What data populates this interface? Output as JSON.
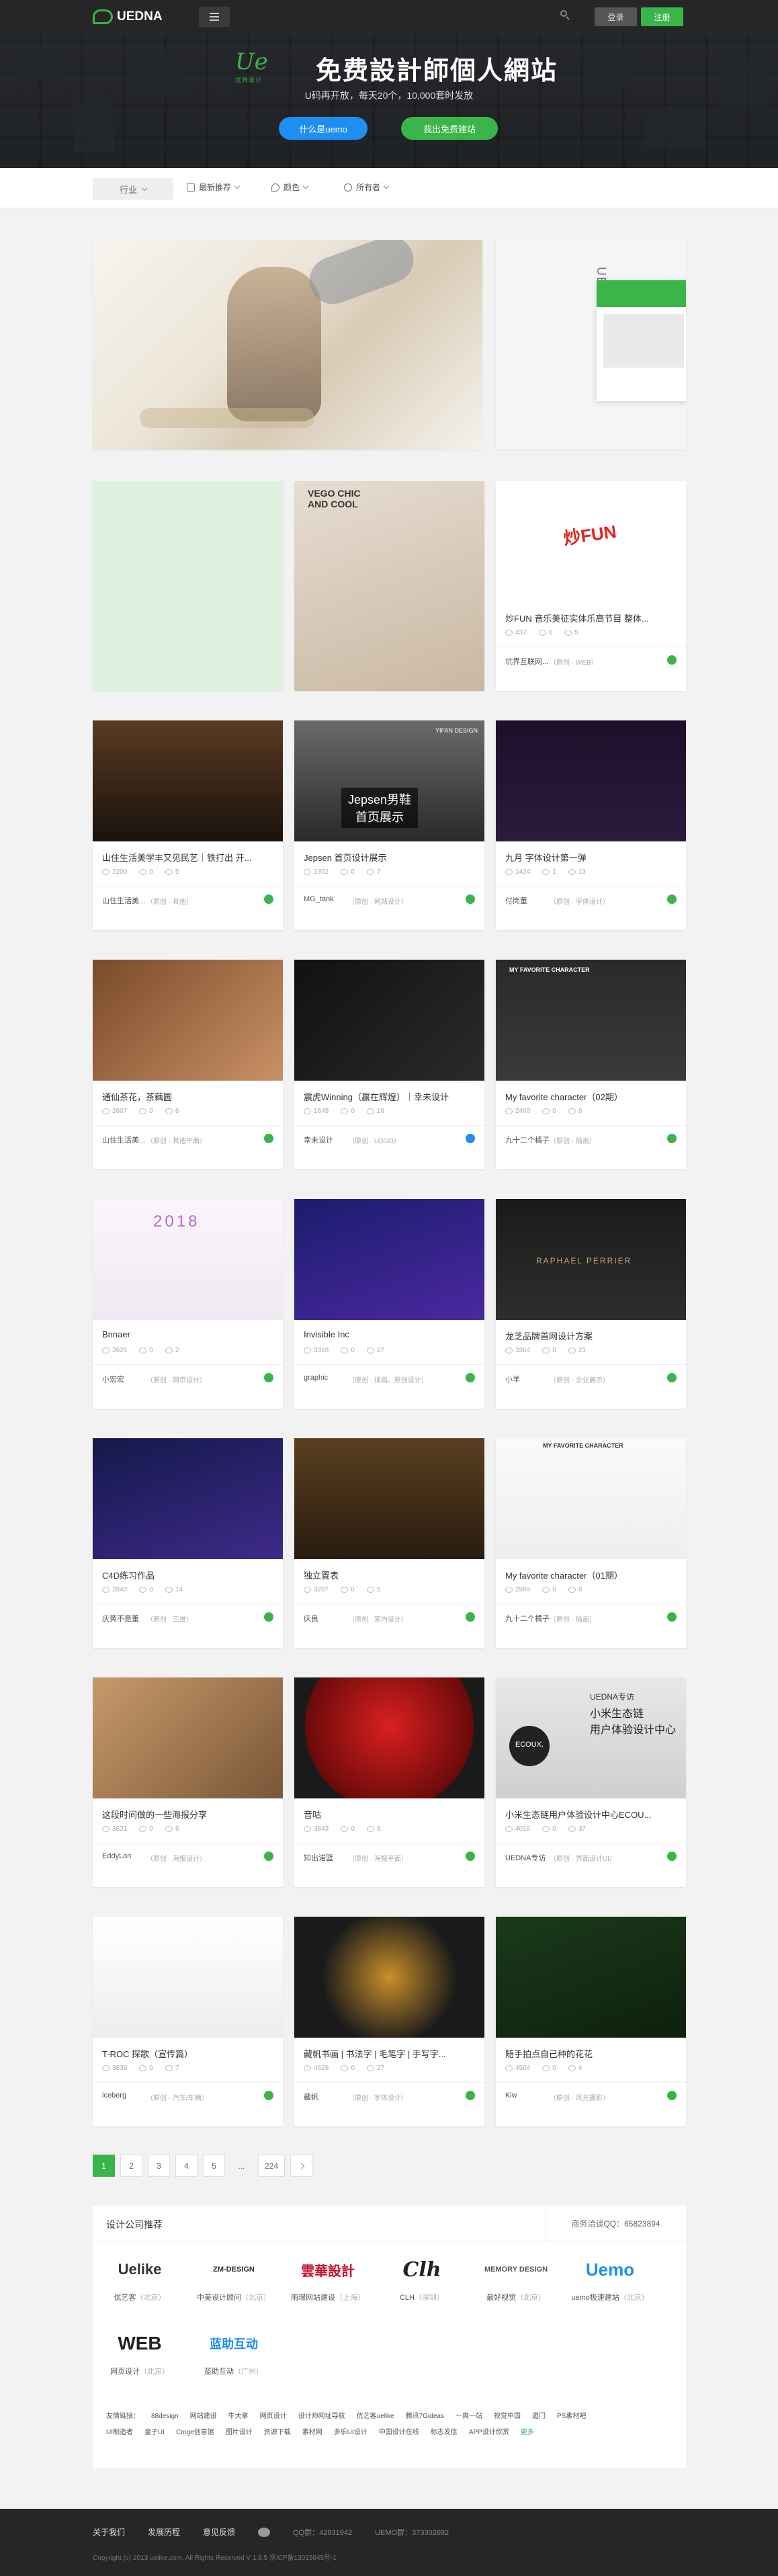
{
  "nav": {
    "logo": "UEDNA",
    "login": "登录",
    "register": "注册"
  },
  "banner": {
    "logo_text": "Ue",
    "logo_sub": "优异设计",
    "title": "免费設計師個人網站",
    "subtitle": "U码再开放，每天20个，10,000套时发放",
    "btn_what": "什么是uemo",
    "btn_free": "我出免费建站"
  },
  "filters": {
    "category": "行业",
    "sort": "最新推荐",
    "color": "颜色",
    "owner": "所有者"
  },
  "cards": [
    {
      "title": "炒FUN 音乐美征实体乐高节目 整体...",
      "views": "437",
      "comments": "0",
      "likes": "5",
      "author": "坑界互联网...",
      "meta": "（原创 · WEB）",
      "badge": "green"
    },
    {
      "title": "山住生活美学丰又见民艺｜铁打出 开...",
      "views": "2200",
      "comments": "0",
      "likes": "5",
      "author": "山住生活美...",
      "meta": "（原创 · 其他）",
      "badge": "green"
    },
    {
      "title": "Jepsen 首页设计展示",
      "views": "1302",
      "comments": "0",
      "likes": "7",
      "author": "MG_tank",
      "meta": "（原创 · 网站设计）",
      "badge": "green"
    },
    {
      "title": "九月 字体设计第一弹",
      "views": "1424",
      "comments": "1",
      "likes": "13",
      "author": "付岗董",
      "meta": "（原创 · 字体设计）",
      "badge": "green"
    },
    {
      "title": "通仙茶花，茶藕圆",
      "views": "2607",
      "comments": "0",
      "likes": "6",
      "author": "山住生活美...",
      "meta": "（原创 · 其他平面）",
      "badge": "green"
    },
    {
      "title": "震虎Winning（赢在辉煌）｜幸未设计",
      "views": "1649",
      "comments": "0",
      "likes": "16",
      "author": "幸未设计",
      "meta": "（原创 · LOGO）",
      "badge": "blue"
    },
    {
      "title": "My favorite character（02期）",
      "views": "2460",
      "comments": "0",
      "likes": "6",
      "author": "九十二个橘子",
      "meta": "（原创 · 插画）",
      "badge": "green"
    },
    {
      "title": "Bnnaer",
      "views": "2626",
      "comments": "0",
      "likes": "2",
      "author": "小宏宏",
      "meta": "（原创 · 网页设计）",
      "badge": "green"
    },
    {
      "title": "Invisible Inc",
      "views": "3318",
      "comments": "0",
      "likes": "27",
      "author": "graphic",
      "meta": "（原创 · 插画、原创设计）",
      "badge": "green"
    },
    {
      "title": "龙芝品牌首网设计方案",
      "views": "3364",
      "comments": "0",
      "likes": "21",
      "author": "小羊",
      "meta": "（原创 · 企业展示）",
      "badge": "green"
    },
    {
      "title": "C4D练习作品",
      "views": "2840",
      "comments": "0",
      "likes": "14",
      "author": "庆黄不是董",
      "meta": "（原创 · 三维）",
      "badge": "green"
    },
    {
      "title": "独立置表",
      "views": "3207",
      "comments": "0",
      "likes": "5",
      "author": "庆良",
      "meta": "（原创 · 室内设计）",
      "badge": "green"
    },
    {
      "title": "My favorite character（01期）",
      "views": "2989",
      "comments": "0",
      "likes": "8",
      "author": "九十二个橘子",
      "meta": "（原创 · 插画）",
      "badge": "green"
    },
    {
      "title": "这段时间做的一些海报分享",
      "views": "3621",
      "comments": "0",
      "likes": "6",
      "author": "EddyLon",
      "meta": "（原创 · 海报设计）",
      "badge": "green"
    },
    {
      "title": "音咕",
      "views": "3843",
      "comments": "0",
      "likes": "9",
      "author": "知出诺篮",
      "meta": "（原创 · 海报平面）",
      "badge": "green"
    },
    {
      "title": "小米生态链用户体验设计中心ECOU...",
      "views": "4010",
      "comments": "0",
      "likes": "37",
      "author": "UEDNA专访",
      "meta": "（原创 · 界面设计UI）",
      "badge": "green"
    },
    {
      "title": "T-ROC 探歌（宣传篇）",
      "views": "3839",
      "comments": "0",
      "likes": "7",
      "author": "iceberg",
      "meta": "（原创 · 汽车/车辆）",
      "badge": "green"
    },
    {
      "title": "藏帆书画 | 书法字 | 毛笔字 | 手写字...",
      "views": "4629",
      "comments": "0",
      "likes": "27",
      "author": "藏帆",
      "meta": "（原创 · 字体设计）",
      "badge": "green"
    },
    {
      "title": "随手拍点自己种的花花",
      "views": "4504",
      "comments": "0",
      "likes": "4",
      "author": "Kiw",
      "meta": "（原创 · 风光摄影）",
      "badge": "green"
    }
  ],
  "image_labels": {
    "uemo": "UEMO企业版",
    "jepsen": "Jepsen男鞋\n首页展示",
    "raphael": "RAPHAEL PERRIER",
    "mfc": "MY FAVORITE CHARACTER",
    "ecoux": "ECOUX.",
    "ecoux_side": "小米生态链\n用户体验设计中心",
    "uedna_tag": "UEDNA专访",
    "yifan": "YIFAN DESIGN",
    "chic": "VEGO CHIC AND COOL",
    "bdate": "2018",
    "chaofun": "炒FUN"
  },
  "pager": [
    "1",
    "2",
    "3",
    "4",
    "5",
    "...",
    "224"
  ],
  "companies": {
    "title": "设计公司推荐",
    "contact": "商务洽谈QQ：65823894",
    "items": [
      {
        "logo": "Uelike",
        "name": "优艺客",
        "city": "（北京）"
      },
      {
        "logo": "ZM-DESIGN",
        "name": "中美设计顾问",
        "city": "（北京）"
      },
      {
        "logo": "雲華設計",
        "name": "雨璟网站建设",
        "city": "（上海）"
      },
      {
        "logo": "Clh",
        "name": "CLH",
        "city": "（深圳）"
      },
      {
        "logo": "MEMORY DESIGN",
        "name": "最好视觉",
        "city": "（北京）"
      },
      {
        "logo": "Uemo",
        "name": "uemo极速建站",
        "city": "（北京）"
      },
      {
        "logo": "WEB",
        "name": "网页设计",
        "city": "（北京）"
      },
      {
        "logo": "蓝助互动",
        "name": "蓝助互动",
        "city": "（广州）"
      }
    ]
  },
  "links": {
    "line1": [
      "友情链接：",
      "88design",
      "网站建设",
      "牛大拿",
      "网页设计",
      "设计师网址导航",
      "优艺客uelike",
      "腾讯7Gideas",
      "一爽一站",
      "视觉中国",
      "遨门",
      "PS素材吧"
    ],
    "line2": [
      "UI制造者",
      "皇子UI",
      "Cmge创意馆",
      "图片设计",
      "资源下载",
      "素材网",
      "多乐UI设计",
      "中国设计在线",
      "标志发信",
      "APP设计欣赏",
      "更多"
    ]
  },
  "footer": {
    "about": "关于我们",
    "history": "发展历程",
    "feedback": "意见反馈",
    "qq1": "QQ群：42831942",
    "qq2": "UEMO群：373302692",
    "copyright": "Copyright (c) 2013 uelike.com. All Rights Reserved V 1.8.5 京ICP备13015845号-1"
  },
  "colors": {
    "accent": "#3ab54a",
    "blue": "#1f8ef1",
    "dark": "#262626"
  }
}
